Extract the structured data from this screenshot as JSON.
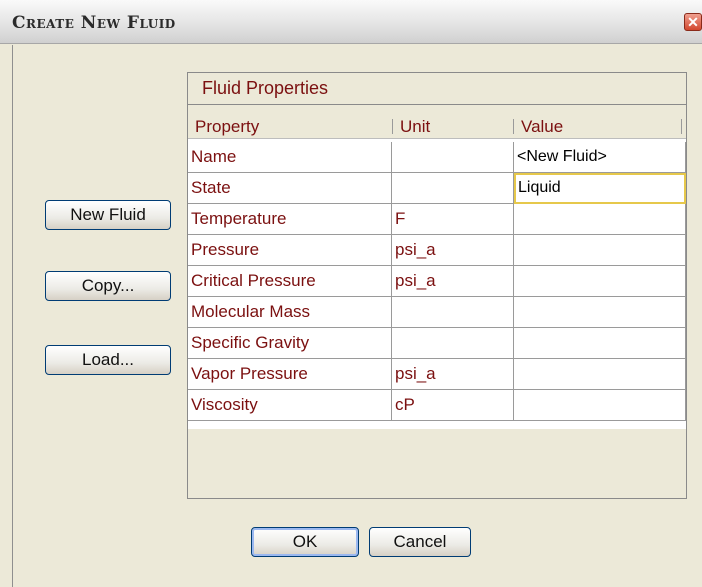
{
  "window": {
    "title": "Create New Fluid",
    "close_glyph": "✕"
  },
  "panel": {
    "title": "Fluid Properties"
  },
  "table": {
    "headers": {
      "property": "Property",
      "unit": "Unit",
      "value": "Value"
    },
    "rows": [
      {
        "property": "Name",
        "unit": "",
        "value": "<New Fluid>"
      },
      {
        "property": "State",
        "unit": "",
        "value": "Liquid"
      },
      {
        "property": "Temperature",
        "unit": "F",
        "value": ""
      },
      {
        "property": "Pressure",
        "unit": "psi_a",
        "value": ""
      },
      {
        "property": "Critical Pressure",
        "unit": "psi_a",
        "value": ""
      },
      {
        "property": "Molecular Mass",
        "unit": "",
        "value": ""
      },
      {
        "property": "Specific Gravity",
        "unit": "",
        "value": ""
      },
      {
        "property": "Vapor Pressure",
        "unit": "psi_a",
        "value": ""
      },
      {
        "property": "Viscosity",
        "unit": "cP",
        "value": ""
      }
    ],
    "selected_cell": "State value"
  },
  "side_buttons": {
    "new_fluid": "New Fluid",
    "copy": "Copy...",
    "load": "Load..."
  },
  "footer": {
    "ok": "OK",
    "cancel": "Cancel"
  }
}
